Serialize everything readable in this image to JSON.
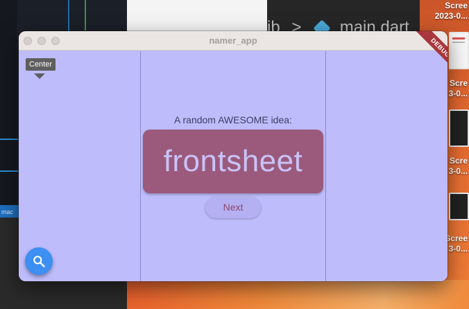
{
  "background": {
    "editor_breadcrumb": {
      "prefix": "ib",
      "separator": ">",
      "file": "main.dart"
    },
    "status_text": "mac",
    "screenshots": [
      {
        "line1": "Scree",
        "line2": "2023-0..."
      },
      {
        "line1": "Scre",
        "line2": "3-0..."
      },
      {
        "line1": "Scre",
        "line2": "3-0..."
      },
      {
        "line1": "Scree",
        "line2": "3-0..."
      }
    ]
  },
  "window": {
    "title": "namer_app",
    "debug_banner": "DEBUG"
  },
  "app": {
    "tooltip": "Center",
    "prompt": "A random AWESOME idea:",
    "word_pair": "frontsheet",
    "next_label": "Next",
    "fab_icon": "search-icon"
  },
  "colors": {
    "background": "#bebcfb",
    "card": "#9b5a7c",
    "word_text": "#c9c3f7",
    "fab": "#3d8ff2",
    "debug_banner": "#a8373e"
  }
}
